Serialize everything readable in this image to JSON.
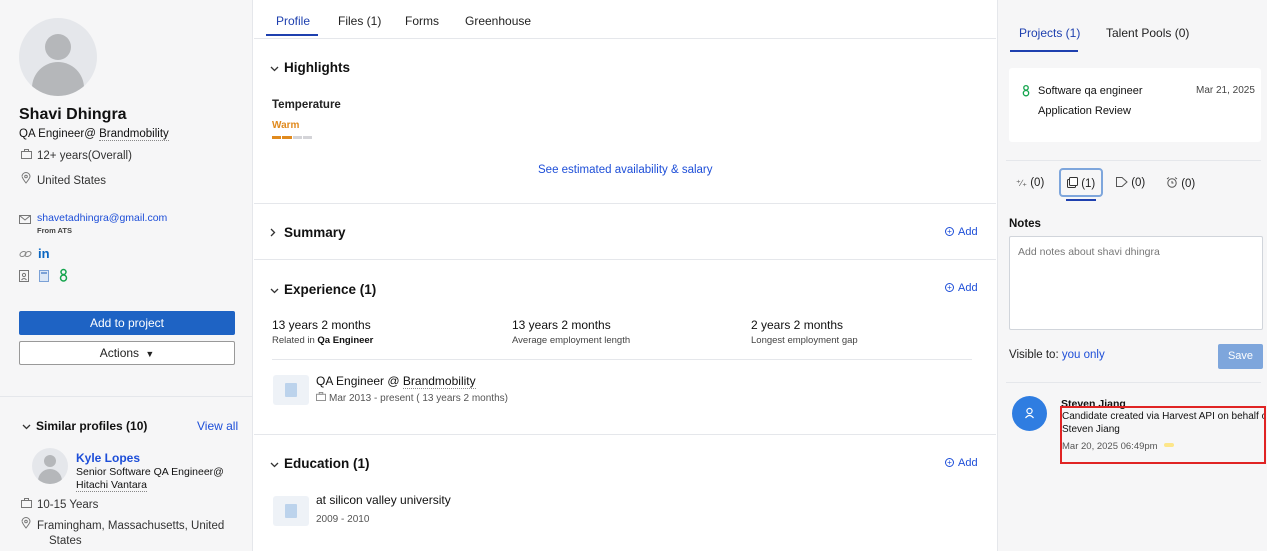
{
  "candidate": {
    "name": "Shavi Dhingra",
    "title_prefix": "QA Engineer@ ",
    "title_company": "Brandmobility",
    "experience": "12+ years(Overall)",
    "location": "United States",
    "email": "shavetadhingra@gmail.com",
    "email_source": "From ATS",
    "linkedin": "in"
  },
  "actions": {
    "add_to_project": "Add to project",
    "actions_label": "Actions"
  },
  "similar": {
    "title": "Similar profiles (10)",
    "view_all": "View all",
    "profile": {
      "name": "Kyle Lopes",
      "role_line1": "Senior Software QA Engineer@",
      "role_company": "Hitachi Vantara",
      "experience": "10-15 Years",
      "location_line1": "Framingham, Massachusetts, United",
      "location_line2": "States"
    }
  },
  "tabs": [
    "Profile",
    "Files (1)",
    "Forms",
    "Greenhouse"
  ],
  "highlights": {
    "title": "Highlights",
    "temperature_label": "Temperature",
    "temperature_value": "Warm",
    "temperature_level": 2,
    "temperature_max": 4,
    "availability_link": "See estimated availability & salary"
  },
  "summary": {
    "title": "Summary",
    "add": "Add"
  },
  "experience": {
    "title": "Experience (1)",
    "add": "Add",
    "stats": [
      {
        "value": "13 years 2 months",
        "label_plain": "Related in ",
        "label_bold": "Qa Engineer"
      },
      {
        "value": "13 years 2 months",
        "label_plain": "Average employment length",
        "label_bold": ""
      },
      {
        "value": "2 years 2 months",
        "label_plain": "Longest employment gap",
        "label_bold": ""
      }
    ],
    "job": {
      "title_prefix": "QA Engineer @ ",
      "company": "Brandmobility",
      "dates": "Mar 2013 - present ( 13 years 2 months)"
    }
  },
  "education": {
    "title": "Education (1)",
    "add": "Add",
    "school": "at silicon valley university",
    "years": "2009 - 2010"
  },
  "right_tabs": [
    "Projects (1)",
    "Talent Pools (0)"
  ],
  "project_card": {
    "name": "Software qa engineer",
    "date": "Mar 21, 2025",
    "stage": "Application Review"
  },
  "filters": [
    {
      "icon": "sequence-icon",
      "count": "(0)"
    },
    {
      "icon": "notes-icon",
      "count": "(1)"
    },
    {
      "icon": "tag-icon",
      "count": "(0)"
    },
    {
      "icon": "alarm-icon",
      "count": "(0)"
    }
  ],
  "notes": {
    "title": "Notes",
    "placeholder": "Add notes about shavi dhingra",
    "visible_label": "Visible to:",
    "visible_value": "you only",
    "save": "Save"
  },
  "note_entry": {
    "author": "Steven Jiang",
    "text_line1": "Candidate created via Harvest API on behalf of",
    "text_line2": "Steven Jiang",
    "timestamp": "Mar 20, 2025 06:49pm"
  },
  "colors": {
    "accent": "#1e40af",
    "primary_button": "#1e63c4",
    "warm": "#e08a1e",
    "highlight_border": "#e02424"
  }
}
